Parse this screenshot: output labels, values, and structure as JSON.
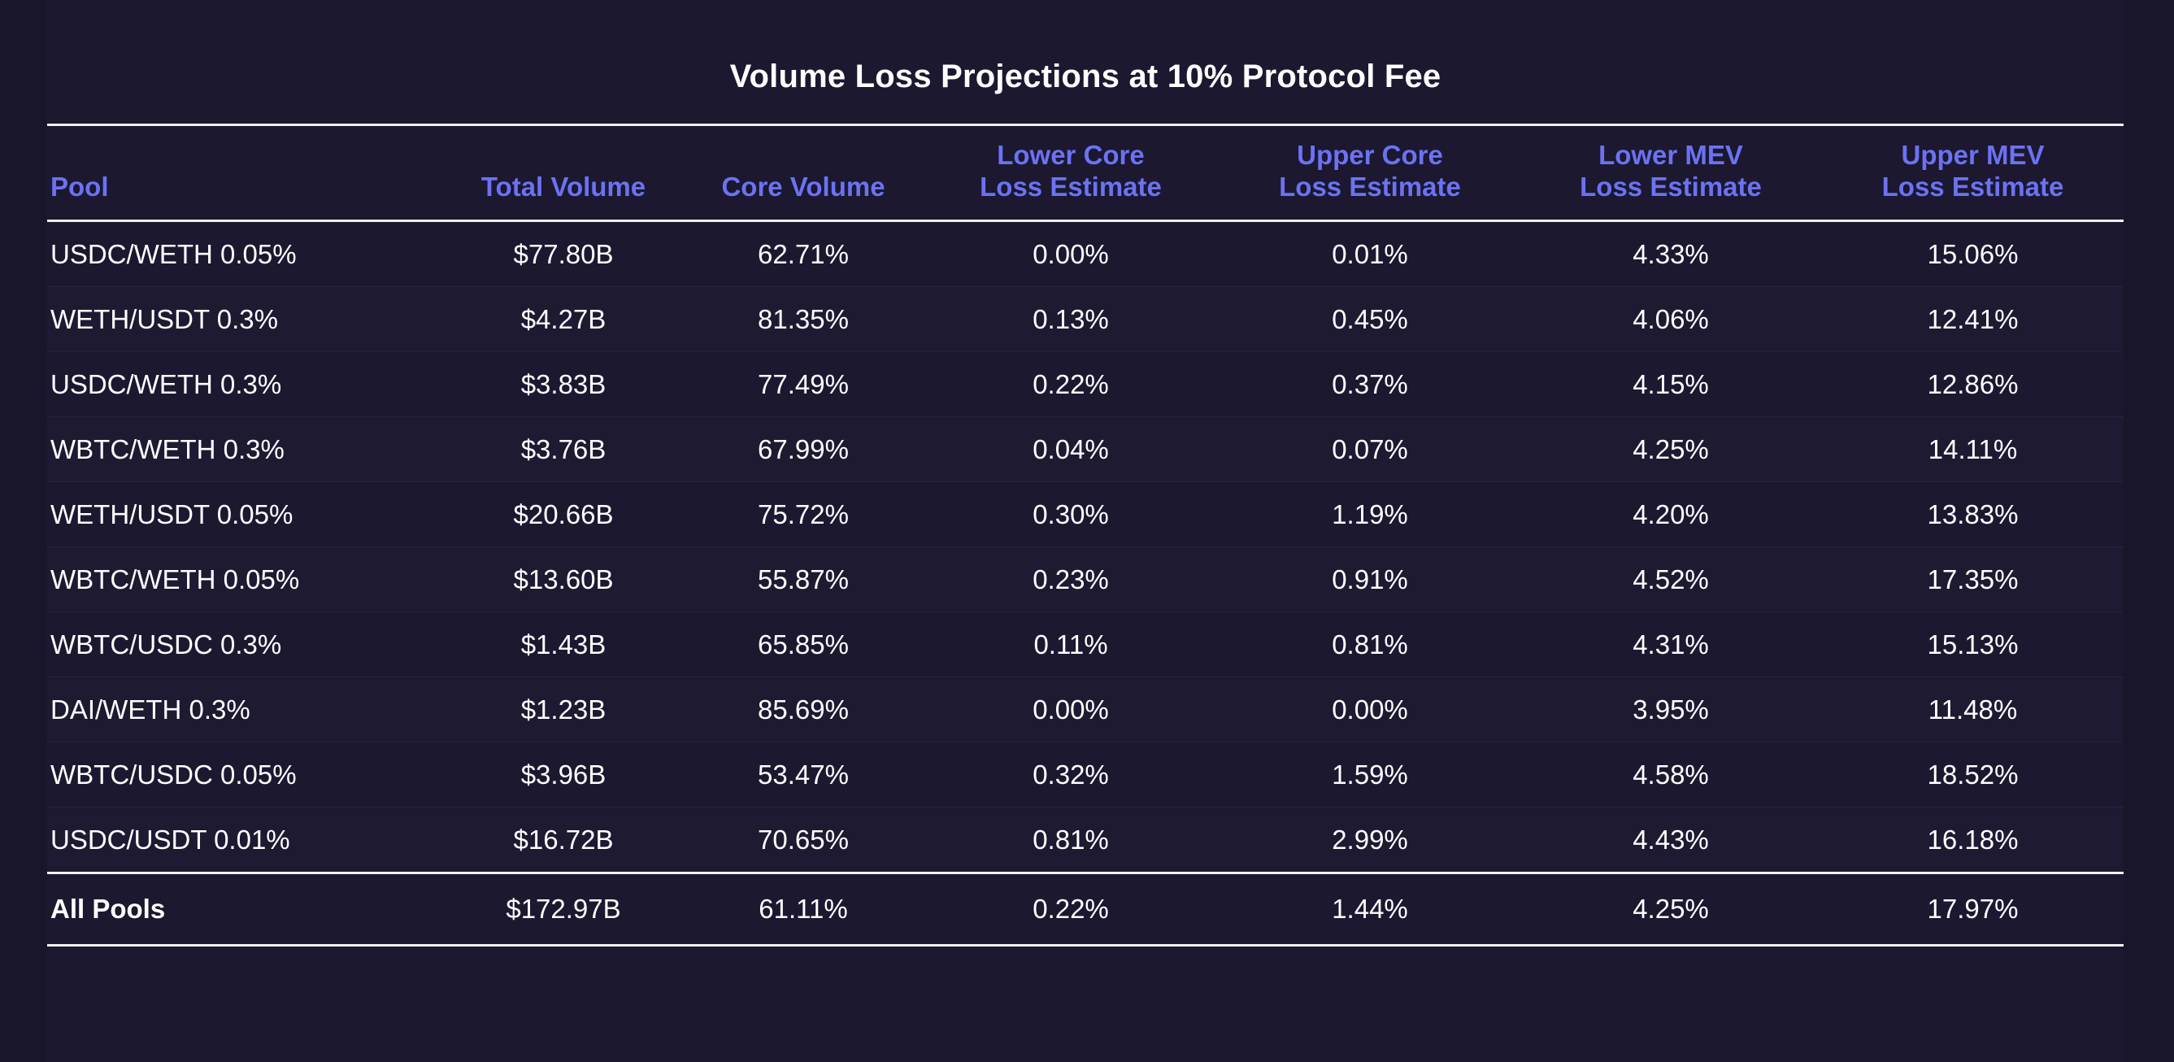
{
  "title": "Volume Loss Projections at 10% Protocol Fee",
  "colors": {
    "background": "#1b1830",
    "gutter": "#191629",
    "header_text": "#6c72f2",
    "body_text": "#ffffff",
    "rule": "#f2f2f5"
  },
  "chart_data": {
    "type": "table",
    "title": "Volume Loss Projections at 10% Protocol Fee",
    "columns": [
      {
        "line1": "Pool",
        "line2": "",
        "align": "left"
      },
      {
        "line1": "Total Volume",
        "line2": "",
        "align": "center"
      },
      {
        "line1": "Core Volume",
        "line2": "",
        "align": "center"
      },
      {
        "line1": "Lower Core",
        "line2": "Loss Estimate",
        "align": "center"
      },
      {
        "line1": "Upper Core",
        "line2": "Loss Estimate",
        "align": "center"
      },
      {
        "line1": "Lower MEV",
        "line2": "Loss Estimate",
        "align": "center"
      },
      {
        "line1": "Upper MEV",
        "line2": "Loss Estimate",
        "align": "center"
      }
    ],
    "rows": [
      {
        "pool": "USDC/WETH 0.05%",
        "total_volume": "$77.80B",
        "core_volume": "62.71%",
        "lower_core_loss": "0.00%",
        "upper_core_loss": "0.01%",
        "lower_mev_loss": "4.33%",
        "upper_mev_loss": "15.06%"
      },
      {
        "pool": "WETH/USDT 0.3%",
        "total_volume": "$4.27B",
        "core_volume": "81.35%",
        "lower_core_loss": "0.13%",
        "upper_core_loss": "0.45%",
        "lower_mev_loss": "4.06%",
        "upper_mev_loss": "12.41%"
      },
      {
        "pool": "USDC/WETH 0.3%",
        "total_volume": "$3.83B",
        "core_volume": "77.49%",
        "lower_core_loss": "0.22%",
        "upper_core_loss": "0.37%",
        "lower_mev_loss": "4.15%",
        "upper_mev_loss": "12.86%"
      },
      {
        "pool": "WBTC/WETH 0.3%",
        "total_volume": "$3.76B",
        "core_volume": "67.99%",
        "lower_core_loss": "0.04%",
        "upper_core_loss": "0.07%",
        "lower_mev_loss": "4.25%",
        "upper_mev_loss": "14.11%"
      },
      {
        "pool": "WETH/USDT 0.05%",
        "total_volume": "$20.66B",
        "core_volume": "75.72%",
        "lower_core_loss": "0.30%",
        "upper_core_loss": "1.19%",
        "lower_mev_loss": "4.20%",
        "upper_mev_loss": "13.83%"
      },
      {
        "pool": "WBTC/WETH 0.05%",
        "total_volume": "$13.60B",
        "core_volume": "55.87%",
        "lower_core_loss": "0.23%",
        "upper_core_loss": "0.91%",
        "lower_mev_loss": "4.52%",
        "upper_mev_loss": "17.35%"
      },
      {
        "pool": "WBTC/USDC 0.3%",
        "total_volume": "$1.43B",
        "core_volume": "65.85%",
        "lower_core_loss": "0.11%",
        "upper_core_loss": "0.81%",
        "lower_mev_loss": "4.31%",
        "upper_mev_loss": "15.13%"
      },
      {
        "pool": "DAI/WETH 0.3%",
        "total_volume": "$1.23B",
        "core_volume": "85.69%",
        "lower_core_loss": "0.00%",
        "upper_core_loss": "0.00%",
        "lower_mev_loss": "3.95%",
        "upper_mev_loss": "11.48%"
      },
      {
        "pool": "WBTC/USDC 0.05%",
        "total_volume": "$3.96B",
        "core_volume": "53.47%",
        "lower_core_loss": "0.32%",
        "upper_core_loss": "1.59%",
        "lower_mev_loss": "4.58%",
        "upper_mev_loss": "18.52%"
      },
      {
        "pool": "USDC/USDT 0.01%",
        "total_volume": "$16.72B",
        "core_volume": "70.65%",
        "lower_core_loss": "0.81%",
        "upper_core_loss": "2.99%",
        "lower_mev_loss": "4.43%",
        "upper_mev_loss": "16.18%"
      }
    ],
    "total_row": {
      "pool": "All Pools",
      "total_volume": "$172.97B",
      "core_volume": "61.11%",
      "lower_core_loss": "0.22%",
      "upper_core_loss": "1.44%",
      "lower_mev_loss": "4.25%",
      "upper_mev_loss": "17.97%"
    }
  }
}
